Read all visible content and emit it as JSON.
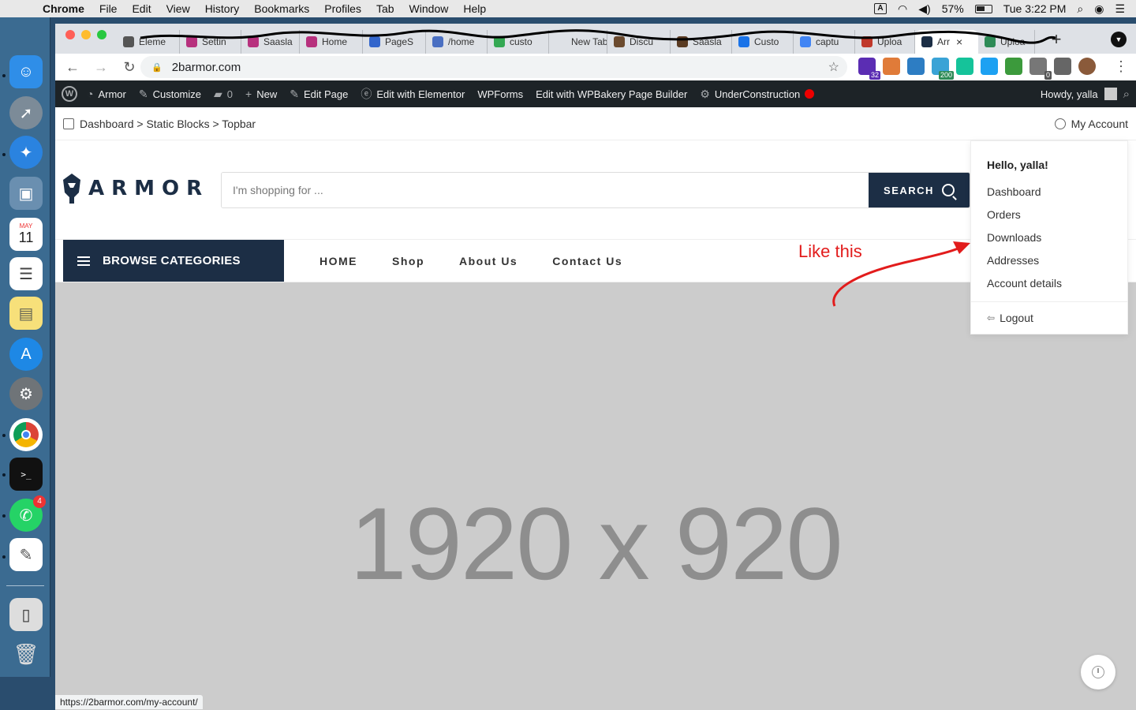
{
  "macos": {
    "app_name": "Chrome",
    "menu": [
      "File",
      "Edit",
      "View",
      "History",
      "Bookmarks",
      "Profiles",
      "Tab",
      "Window",
      "Help"
    ],
    "input_indicator": "A",
    "battery": "57%",
    "clock": "Tue 3:22 PM"
  },
  "dock": {
    "items": [
      "finder-icon",
      "launchpad-icon",
      "safari-icon",
      "preview-icon",
      "calendar-icon",
      "reminders-icon",
      "notes-icon",
      "app-store-icon",
      "system-preferences-icon",
      "chrome-icon",
      "terminal-icon",
      "whatsapp-icon",
      "textedit-icon",
      "iphone-backup-icon",
      "trash-icon"
    ],
    "calendar_month": "MAY",
    "calendar_day": "11",
    "whatsapp_badge": "4"
  },
  "browser": {
    "tabs": [
      {
        "label": "Eleme",
        "color": "#555"
      },
      {
        "label": "Settin",
        "color": "#b7317e"
      },
      {
        "label": "Saasla",
        "color": "#b7317e"
      },
      {
        "label": "Home",
        "color": "#b7317e"
      },
      {
        "label": "PageS",
        "color": "#3366cc"
      },
      {
        "label": "/home",
        "color": "#4a6fc2"
      },
      {
        "label": "custo",
        "color": "#34a853"
      },
      {
        "label": "New Tab",
        "color": "#dee1e6"
      },
      {
        "label": "Discu",
        "color": "#6b4a2e"
      },
      {
        "label": "Saasla",
        "color": "#5a3b22"
      },
      {
        "label": "Custo",
        "color": "#1a73e8"
      },
      {
        "label": "captu",
        "color": "#4285f4"
      },
      {
        "label": "Uploa",
        "color": "#c0392b"
      },
      {
        "label": "Arr",
        "color": "#1c2e45",
        "active": true
      },
      {
        "label": "Uploa",
        "color": "#2e8b57"
      }
    ],
    "url": "2barmor.com",
    "extensions": [
      {
        "name": "graduation-cap-icon",
        "color": "#5b2db3",
        "count": "32",
        "count_color": "#5b2db3"
      },
      {
        "name": "wordpress-ext-icon",
        "color": "#e07b39",
        "count": "",
        "count_color": ""
      },
      {
        "name": "screenshot-ext-icon",
        "color": "#2d7dc3",
        "count": "",
        "count_color": ""
      },
      {
        "name": "cloud-ext-icon",
        "color": "#3aa3d6",
        "count": "200",
        "count_color": "#2e8b57"
      },
      {
        "name": "grammarly-icon",
        "color": "#15c39a",
        "count": "",
        "count_color": ""
      },
      {
        "name": "translate-ext-icon",
        "color": "#1da1f2",
        "count": "",
        "count_color": ""
      },
      {
        "name": "image-ext-icon",
        "color": "#3c9a3c",
        "count": "",
        "count_color": ""
      },
      {
        "name": "help-ext-icon",
        "color": "#777",
        "count": "0",
        "count_color": "#555"
      },
      {
        "name": "puzzle-icon",
        "color": "#666",
        "count": "",
        "count_color": ""
      },
      {
        "name": "profile-avatar-icon",
        "color": "#8a5a3a",
        "count": "",
        "count_color": ""
      }
    ],
    "status_url": "https://2barmor.com/my-account/"
  },
  "adminbar": {
    "site_name": "Armor",
    "customize": "Customize",
    "comments": "0",
    "new": "New",
    "edit_page": "Edit Page",
    "elementor": "Edit with Elementor",
    "wpforms": "WPForms",
    "wpbakery": "Edit with WPBakery Page Builder",
    "underconstruction": "UnderConstruction",
    "howdy": "Howdy, yalla"
  },
  "site": {
    "breadcrumb": "Dashboard > Static Blocks > Topbar",
    "my_account": "My Account",
    "logo_text": "ARMOR",
    "search_placeholder": "I'm shopping for ...",
    "search_button": "SEARCH",
    "browse": "BROWSE CATEGORIES",
    "nav": [
      "HOME",
      "Shop",
      "About Us",
      "Contact Us"
    ],
    "hero_text": "1920 x 920",
    "annotation": "Like this",
    "annotation_color": "#e21c1c",
    "brand_color": "#1c2e45"
  },
  "account_dropdown": {
    "hello": "Hello, yalla!",
    "items": [
      "Dashboard",
      "Orders",
      "Downloads",
      "Addresses",
      "Account details"
    ],
    "logout": "Logout"
  }
}
